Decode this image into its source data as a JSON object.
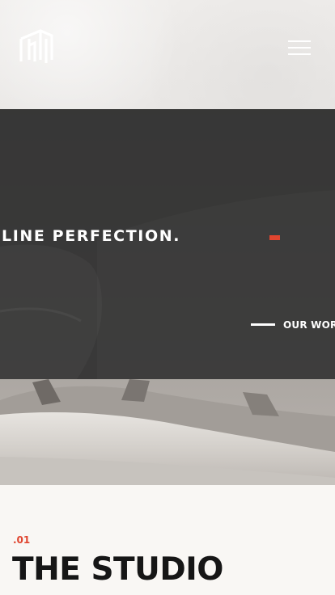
{
  "header": {
    "logo": "building-logo-icon",
    "menu_icon": "hamburger-menu-icon"
  },
  "hero": {
    "title": "LINE PERFECTION.",
    "cta_label": "OUR WORK",
    "accent_color": "#e0452f",
    "overlay_color": "#303030"
  },
  "studio": {
    "number": ".01",
    "title": "THE STUDIO"
  }
}
